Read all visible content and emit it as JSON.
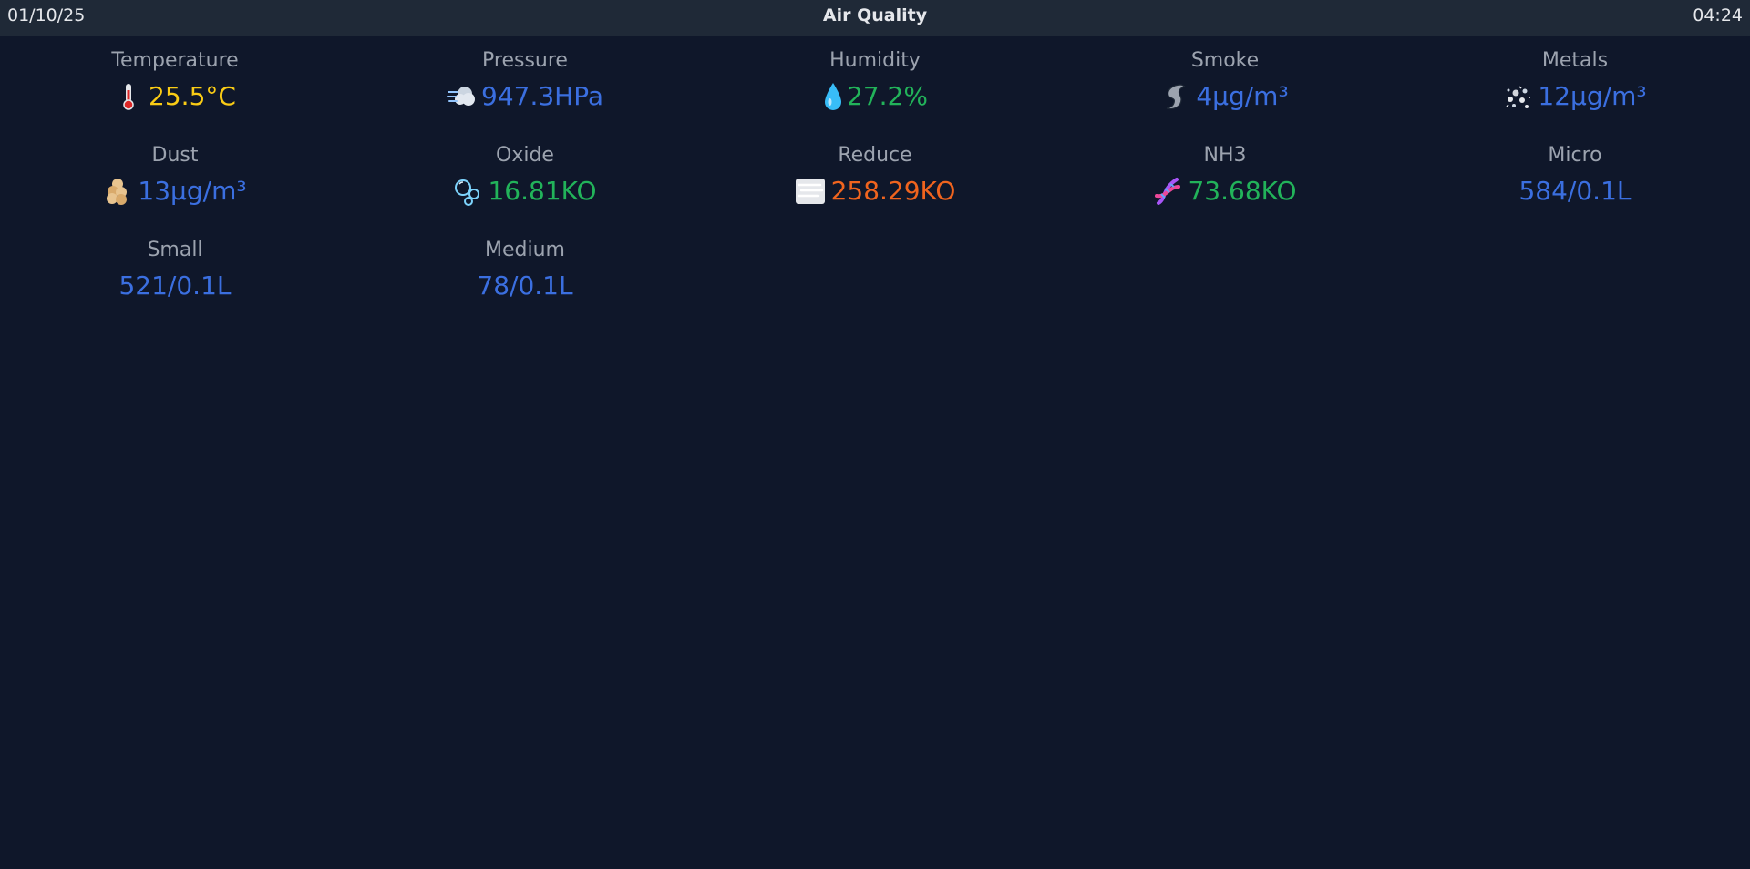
{
  "header": {
    "date": "01/10/25",
    "title": "Air Quality",
    "time": "04:24"
  },
  "colors": {
    "background": "#0f172a",
    "header_bg": "#1f2937",
    "label": "#9ca3af",
    "yellow": "#facc15",
    "blue": "#3b6fe0",
    "green": "#22b35a",
    "orange": "#f0641e"
  },
  "metrics": [
    {
      "label": "Temperature",
      "value": "25.5°C",
      "icon": "thermometer-icon",
      "color": "#facc15"
    },
    {
      "label": "Pressure",
      "value": "947.3HPa",
      "icon": "wind-icon",
      "color": "#3b6fe0"
    },
    {
      "label": "Humidity",
      "value": "27.2%",
      "icon": "droplet-icon",
      "color": "#22b35a"
    },
    {
      "label": "Smoke",
      "value": "4µg/m³",
      "icon": "smoke-icon",
      "color": "#3b6fe0"
    },
    {
      "label": "Metals",
      "value": "12µg/m³",
      "icon": "particles-icon",
      "color": "#3b6fe0"
    },
    {
      "label": "Dust",
      "value": "13µg/m³",
      "icon": "dust-icon",
      "color": "#3b6fe0"
    },
    {
      "label": "Oxide",
      "value": "16.81KO",
      "icon": "bubbles-icon",
      "color": "#22b35a"
    },
    {
      "label": "Reduce",
      "value": "258.29KO",
      "icon": "fog-icon",
      "color": "#f0641e"
    },
    {
      "label": "NH3",
      "value": "73.68KO",
      "icon": "dna-icon",
      "color": "#22b35a"
    },
    {
      "label": "Micro",
      "value": "584/0.1L",
      "icon": "",
      "color": "#3b6fe0"
    },
    {
      "label": "Small",
      "value": "521/0.1L",
      "icon": "",
      "color": "#3b6fe0"
    },
    {
      "label": "Medium",
      "value": "78/0.1L",
      "icon": "",
      "color": "#3b6fe0"
    }
  ]
}
